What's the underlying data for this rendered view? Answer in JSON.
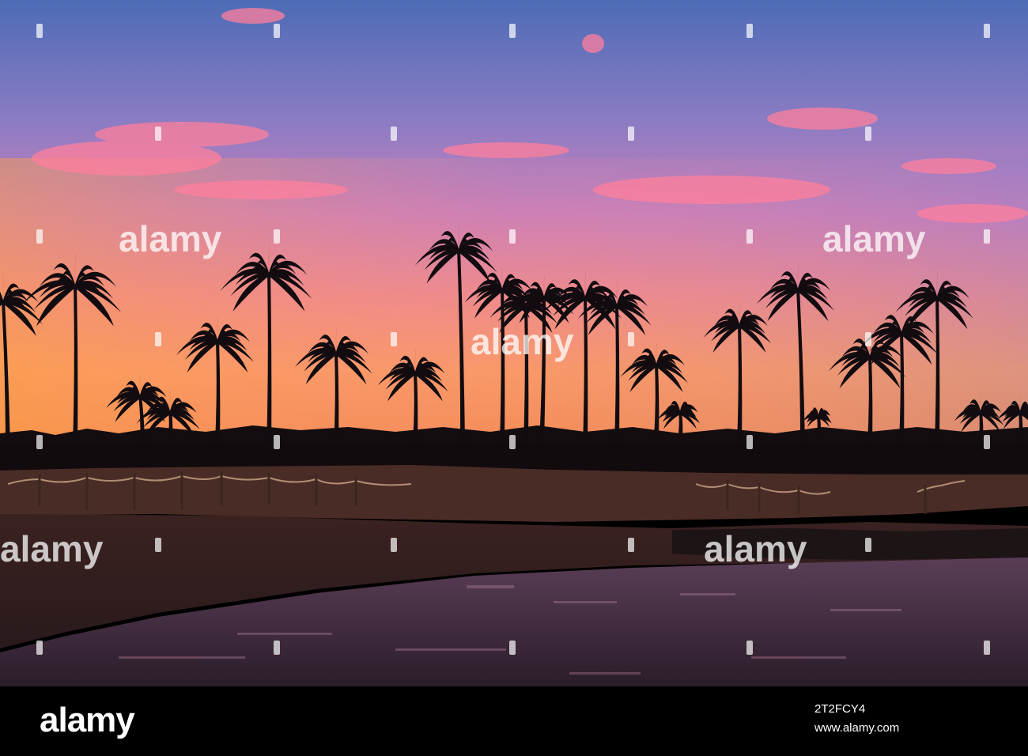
{
  "watermark": {
    "text": "alamy"
  },
  "footer": {
    "brand": "alamy",
    "image_id": "2T2FCY4",
    "site": "www.alamy.com"
  },
  "colors": {
    "sky_top": "#5a6fb0",
    "sky_mid": "#d77ab0",
    "horizon": "#f4883c",
    "silhouette": "#120c10",
    "water": "#6b4a63"
  }
}
